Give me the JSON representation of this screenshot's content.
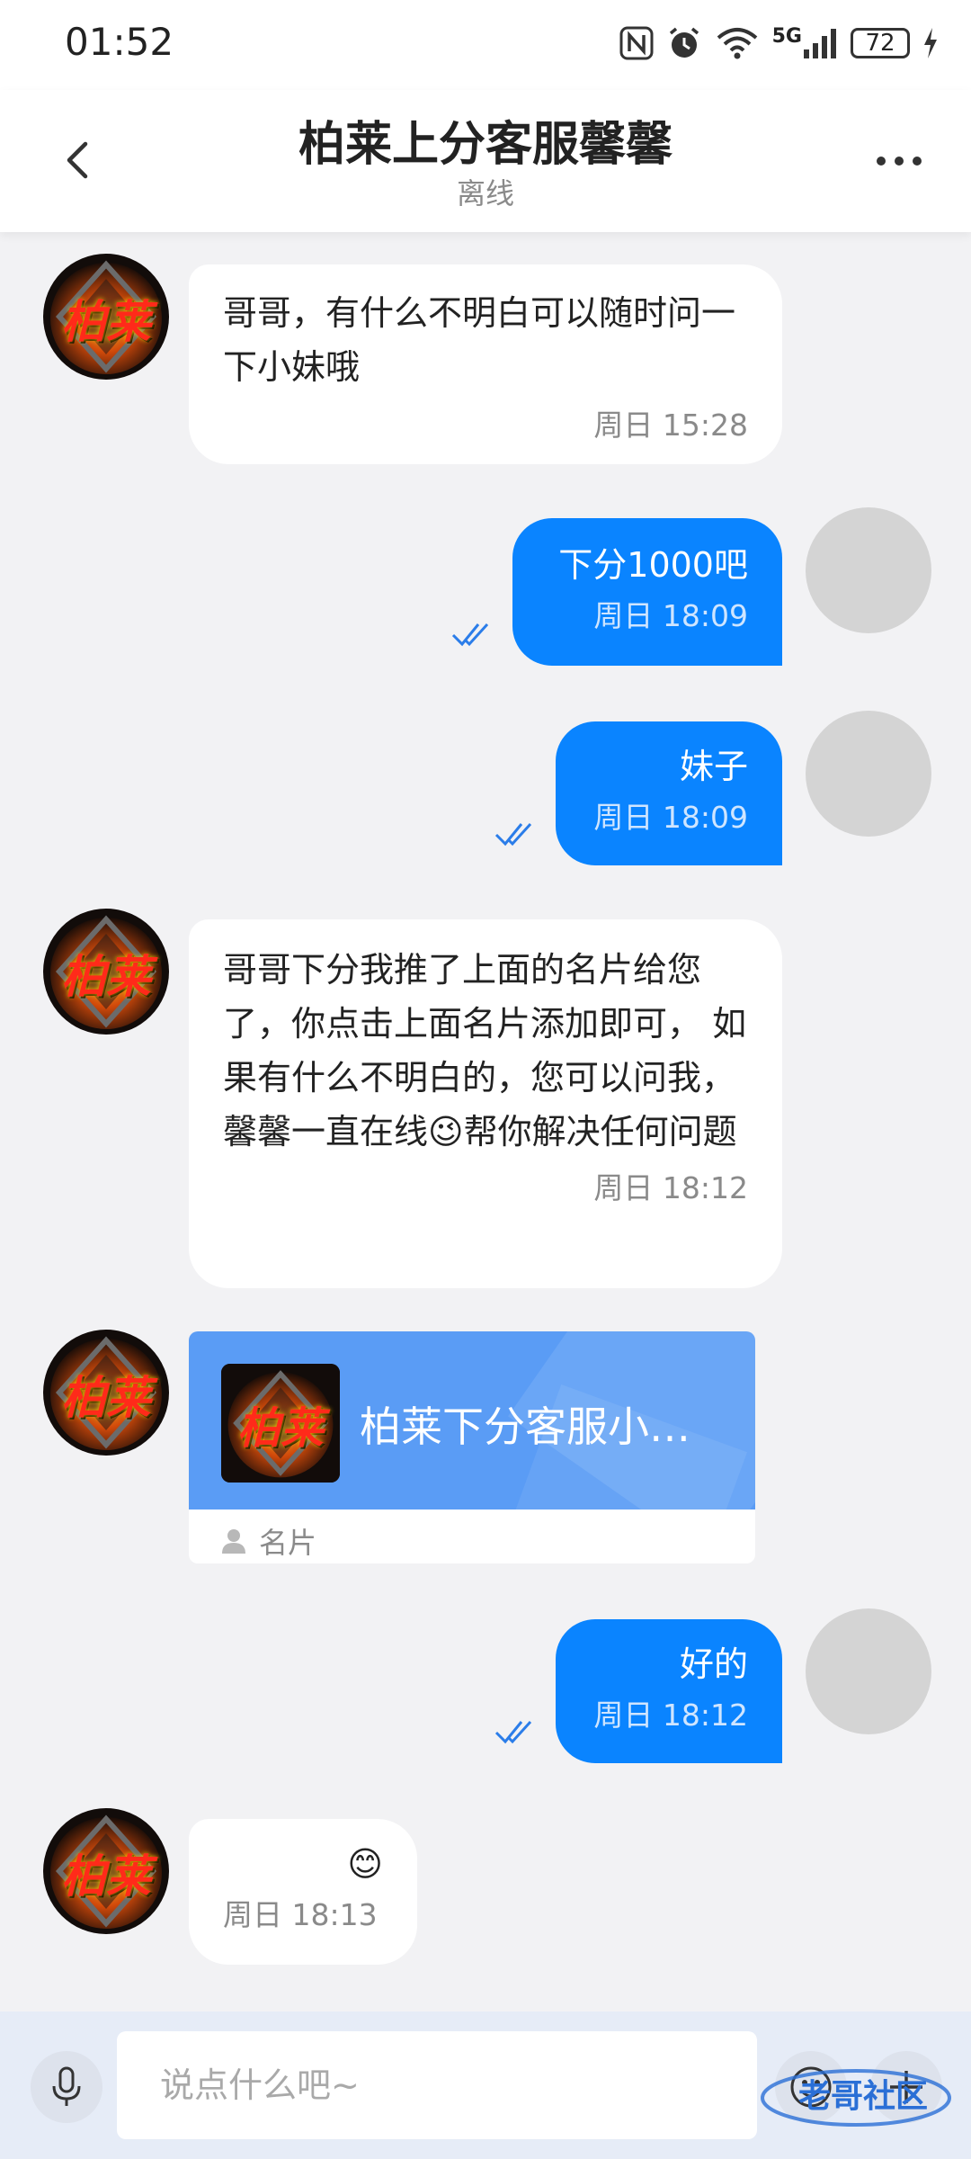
{
  "status_bar": {
    "time": "01:52",
    "battery": "72",
    "signal_label": "5G",
    "icons": [
      "nfc-icon",
      "alarm-icon",
      "wifi-icon",
      "signal-icon",
      "battery-icon",
      "charging-icon"
    ]
  },
  "header": {
    "title": "柏莱上分客服馨馨",
    "status": "离线",
    "icons": [
      "back-icon",
      "more-icon"
    ]
  },
  "messages": [
    {
      "direction": "incoming",
      "text": "哥哥，有什么不明白可以随时问一下小妹哦",
      "time": "周日 15:28"
    },
    {
      "direction": "outgoing",
      "text": "下分1000吧",
      "time": "周日 18:09",
      "read": true
    },
    {
      "direction": "outgoing",
      "text": "妹子",
      "time": "周日 18:09",
      "read": true
    },
    {
      "direction": "incoming",
      "text": "哥哥下分我推了上面的名片给您了，你点击上面名片添加即可，  如果有什么不明白的，您可以问我，馨馨一直在线😉帮你解决任何问题",
      "time": "周日 18:12"
    },
    {
      "direction": "incoming",
      "type": "card",
      "card_name": "柏莱下分客服小…",
      "card_type": "名片"
    },
    {
      "direction": "outgoing",
      "text": "好的",
      "time": "周日 18:12",
      "read": true
    },
    {
      "direction": "incoming",
      "text": "😊",
      "time": "周日 18:13"
    }
  ],
  "avatar_logo_text": "柏莱",
  "input_bar": {
    "placeholder": "说点什么吧~",
    "icons": [
      "mic-icon",
      "emoji-icon",
      "plus-icon"
    ]
  },
  "colors": {
    "outgoing_bubble": "#0a84ff",
    "incoming_bubble": "#ffffff",
    "background": "#f2f2f4",
    "card_blue": "#5a9cf5"
  },
  "watermark": "老哥社区"
}
